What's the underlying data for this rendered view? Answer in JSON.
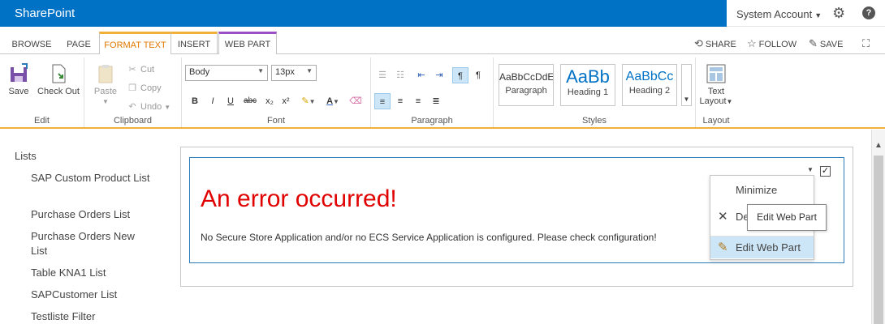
{
  "suite": {
    "brand": "SharePoint",
    "user": "System Account",
    "brand_color": "#0072c6"
  },
  "tabs": {
    "browse": "BROWSE",
    "page": "PAGE",
    "format_text": "FORMAT TEXT",
    "insert": "INSERT",
    "web_part": "WEB PART"
  },
  "page_actions": {
    "share": "SHARE",
    "follow": "FOLLOW",
    "save": "SAVE"
  },
  "ribbon": {
    "edit": {
      "save": "Save",
      "check_out": "Check Out",
      "label": "Edit"
    },
    "clipboard": {
      "paste": "Paste",
      "cut": "Cut",
      "copy": "Copy",
      "undo": "Undo",
      "label": "Clipboard"
    },
    "font": {
      "family": "Body",
      "size": "13px",
      "bold": "B",
      "italic": "I",
      "underline": "U",
      "strike": "abc",
      "subscript": "x₂",
      "superscript": "x²",
      "label": "Font"
    },
    "paragraph": {
      "label": "Paragraph"
    },
    "styles": {
      "paragraph_sample": "AaBbCcDdE",
      "paragraph_name": "Paragraph",
      "h1_sample": "AaBb",
      "h1_name": "Heading 1",
      "h2_sample": "AaBbCc",
      "h2_name": "Heading 2",
      "label": "Styles"
    },
    "layout": {
      "text_layout_line1": "Text",
      "text_layout_line2": "Layout",
      "label": "Layout"
    }
  },
  "leftnav": {
    "heading": "Lists",
    "items": [
      {
        "label": "SAP Custom Product List"
      },
      {
        "label": "Purchase Orders List"
      },
      {
        "label": "Purchase Orders New List"
      },
      {
        "label": "Table KNA1 List"
      },
      {
        "label": "SAPCustomer List"
      },
      {
        "label": "Testliste Filter"
      }
    ]
  },
  "webpart": {
    "error_title": "An error occurred!",
    "error_message": "No Secure Store Application and/or no ECS Service Application is configured. Please check configuration!",
    "menu": {
      "minimize": "Minimize",
      "delete_partial": "De",
      "edit": "Edit Web Part"
    },
    "tooltip": "Edit Web Part",
    "error_color": "#e10000"
  }
}
